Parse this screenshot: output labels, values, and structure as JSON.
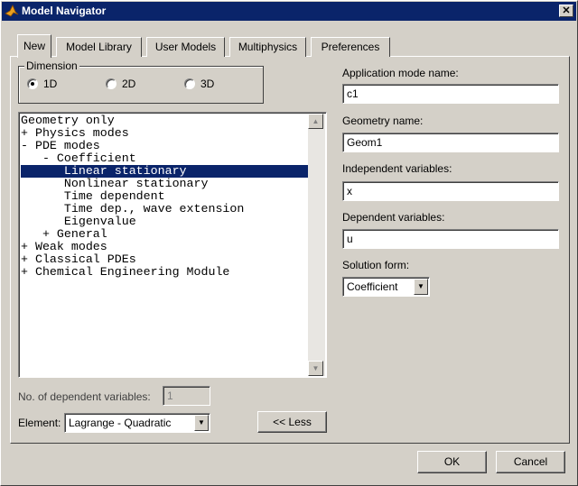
{
  "window": {
    "title": "Model Navigator",
    "close_glyph": "✕"
  },
  "tabs": [
    {
      "label": "New",
      "active": true
    },
    {
      "label": "Model Library"
    },
    {
      "label": "User Models"
    },
    {
      "label": "Multiphysics"
    },
    {
      "label": "Preferences"
    }
  ],
  "dimension": {
    "label": "Dimension",
    "options": [
      {
        "label": "1D",
        "checked": true
      },
      {
        "label": "2D"
      },
      {
        "label": "3D"
      }
    ]
  },
  "tree": {
    "items": [
      "Geometry only",
      "+ Physics modes",
      "- PDE modes",
      "   - Coefficient",
      "      Linear stationary",
      "      Nonlinear stationary",
      "      Time dependent",
      "      Time dep., wave extension",
      "      Eigenvalue",
      "   + General",
      "+ Weak modes",
      "+ Classical PDEs",
      "+ Chemical Engineering Module"
    ],
    "selected_index": 4,
    "scroll_up_glyph": "▲",
    "scroll_down_glyph": "▼"
  },
  "dependent_count": {
    "label": "No. of dependent variables:",
    "value": "1"
  },
  "element": {
    "label": "Element:",
    "value": "Lagrange - Quadratic",
    "arrow_glyph": "▼"
  },
  "less_button": "<< Less",
  "app_mode": {
    "label": "Application mode name:",
    "value": "c1"
  },
  "geometry": {
    "label": "Geometry name:",
    "value": "Geom1"
  },
  "independent": {
    "label": "Independent variables:",
    "value": "x"
  },
  "dependent": {
    "label": "Dependent variables:",
    "value": "u"
  },
  "solution_form": {
    "label": "Solution form:",
    "value": "Coefficient",
    "arrow_glyph": "▼"
  },
  "buttons": {
    "ok": "OK",
    "cancel": "Cancel"
  },
  "colors": {
    "titlebar": "#0a246a",
    "face": "#d4d0c8",
    "selection": "#0a246a"
  },
  "icons": {
    "title_icon": "matlab-logo-icon"
  }
}
